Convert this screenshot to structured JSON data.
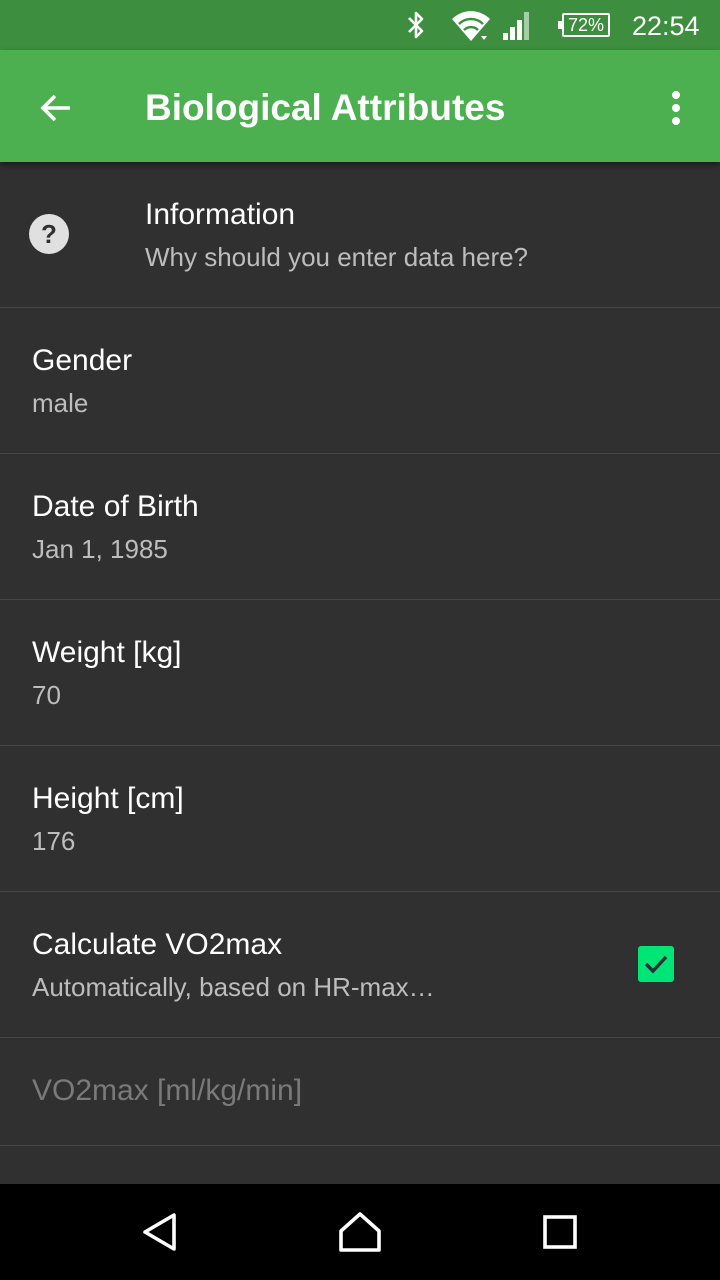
{
  "status_bar": {
    "battery": "72%",
    "time": "22:54",
    "icons": [
      "bluetooth-icon",
      "wifi-icon",
      "cell-signal-icon",
      "battery-icon"
    ]
  },
  "app_bar": {
    "title": "Biological Attributes",
    "back_icon": "arrow-back-icon",
    "menu_icon": "more-vert-icon",
    "color": "#4caf50"
  },
  "list": {
    "information": {
      "title": "Information",
      "subtitle": "Why should you enter data here?",
      "icon": "help-circle-icon"
    },
    "gender": {
      "title": "Gender",
      "value": "male"
    },
    "date_of_birth": {
      "title": "Date of Birth",
      "value": "Jan 1, 1985"
    },
    "weight": {
      "title": "Weight [kg]",
      "value": "70"
    },
    "height": {
      "title": "Height [cm]",
      "value": "176"
    },
    "calculate_vo2max": {
      "title": "Calculate VO2max",
      "subtitle": "Automatically, based on HR-max…",
      "checked": true,
      "accent": "#00e676"
    },
    "vo2max": {
      "title": "VO2max [ml/kg/min]",
      "disabled": true
    }
  },
  "nav_bar": {
    "icons": [
      "nav-back-icon",
      "nav-home-icon",
      "nav-recents-icon"
    ]
  }
}
